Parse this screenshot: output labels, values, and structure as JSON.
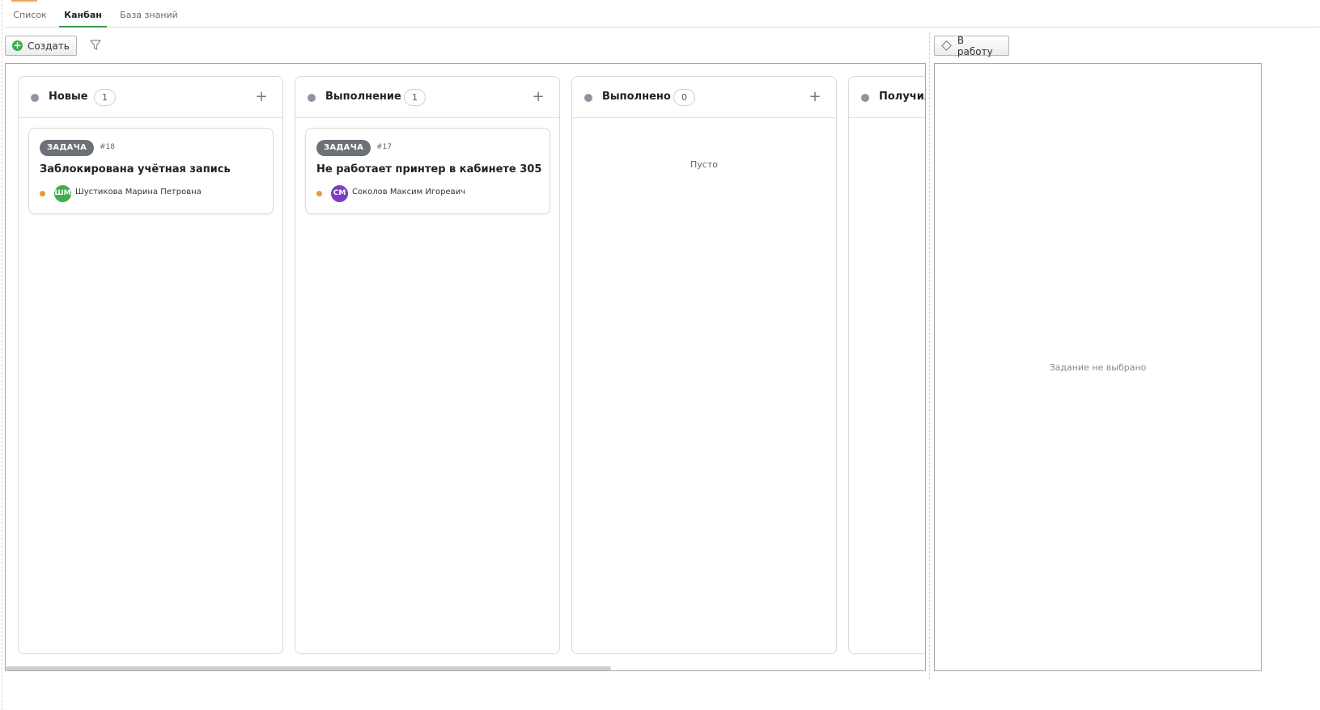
{
  "tabs": [
    {
      "label": "Список",
      "active": false
    },
    {
      "label": "Канбан",
      "active": true
    },
    {
      "label": "База знаний",
      "active": false
    }
  ],
  "toolbar": {
    "create_label": "Создать",
    "create_icon": "plus-circle-icon",
    "filter_icon": "filter-icon"
  },
  "detail_toolbar": {
    "work_label": "В работу",
    "work_icon": "diamond-icon"
  },
  "columns": [
    {
      "title": "Новые",
      "count": "1",
      "cards": [
        {
          "type": "ЗАДАЧА",
          "number": "#18",
          "title": "Заблокирована учётная запись",
          "assignee_initials": "ШМ",
          "assignee": "Шустикова Марина Петровна",
          "avatar_color": "#3fae4a"
        }
      ]
    },
    {
      "title": "Выполнение",
      "count": "1",
      "cards": [
        {
          "type": "ЗАДАЧА",
          "number": "#17",
          "title": "Не работает принтер в кабинете 305",
          "assignee_initials": "СМ",
          "assignee": "Соколов Максим Игоревич",
          "avatar_color": "#7b3fbf"
        }
      ]
    },
    {
      "title": "Выполнено",
      "count": "0",
      "empty_text": "Пусто",
      "cards": []
    },
    {
      "title": "Получил",
      "cards": []
    }
  ],
  "detail": {
    "empty_text": "Задание не выбрано"
  },
  "colors": {
    "accent": "#3a9a4a",
    "status_dot": "#8e95a0",
    "priority": "#e59a3c",
    "badge_bg": "#6c7177"
  }
}
